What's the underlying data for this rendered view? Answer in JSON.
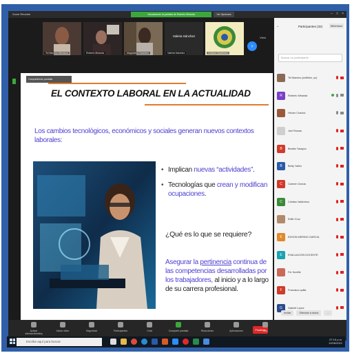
{
  "window": {
    "title": "Zoom Reunión",
    "banner": "Visualizando la pantalla de Roberto Miranda",
    "view_button": "Ver Opciones",
    "controls": [
      "–",
      "□",
      "×"
    ]
  },
  "thumbnails": [
    {
      "name": "Tel Maximo Mendoza",
      "kind": "video",
      "color": "#6b4a3a"
    },
    {
      "name": "Roberto Miranda",
      "kind": "video",
      "color": "#3a2a2a"
    },
    {
      "name": "Magdalena Sanchez",
      "kind": "video",
      "color": "#7a6a55"
    },
    {
      "name": "Valeria Sánchez",
      "kind": "name",
      "center_label": "Valeria Sánchez"
    },
    {
      "name": "Cristian Valdivieso",
      "kind": "logo",
      "color": "#d8c84a"
    }
  ],
  "view_toggle": "Vista",
  "slide": {
    "tab_label": "Compartiendo pantalla",
    "title": "EL CONTEXTO LABORAL EN LA ACTUALIDAD",
    "intro": "Los cambios tecnológicos, económicos y sociales generan nuevos contextos laborales:",
    "bullet1_pre": "Implican ",
    "bullet1_hl": "nuevas “actividades”",
    "bullet1_post": ".",
    "bullet2_pre": "Tecnologías que ",
    "bullet2_hl": "crean y modifican ocupaciones",
    "bullet2_post": ".",
    "question": "¿Qué es lo que se requiere?",
    "answer_a": "Asegurar la ",
    "answer_u": "pertinencia",
    "answer_b": " continua de las competencias desarrolladas por los trabajadores,",
    "answer_c": " al inicio y a lo largo de su carrera profesional.",
    "accent_color": "#e07b2e",
    "highlight_color": "#4b3fd0"
  },
  "participants": {
    "header": "Participantes (32)",
    "popout_label": "Minimizar",
    "search_placeholder": "Buscar un participante",
    "list": [
      {
        "name": "Tel Maximo (anfitrión, yo)",
        "avatar": "photo",
        "color": "#8a6a55",
        "mic": false,
        "cam": false
      },
      {
        "name": "Roberto Miranda",
        "avatar": "R",
        "color": "#7a3fc8",
        "mic": true,
        "cam": true,
        "active": true
      },
      {
        "name": "Héctor Chacha",
        "avatar": "photo",
        "color": "#9a5a3a",
        "mic": true,
        "cam": true
      },
      {
        "name": "Joel Romas",
        "avatar": "photo",
        "color": "#cfcfcf",
        "mic": false,
        "cam": false
      },
      {
        "name": "Beatriz Tasayco",
        "avatar": "B",
        "color": "#d13a2a",
        "mic": false,
        "cam": false
      },
      {
        "name": "Betty Yañez",
        "avatar": "B",
        "color": "#2a5aa8",
        "mic": false,
        "cam": false
      },
      {
        "name": "Carmen Garcia",
        "avatar": "C",
        "color": "#d13a2a",
        "mic": false,
        "cam": false
      },
      {
        "name": "Cristian Valdivieso",
        "avatar": "C",
        "color": "#3a8a3a",
        "mic": false,
        "cam": false
      },
      {
        "name": "Edith Cruz",
        "avatar": "photo",
        "color": "#b08a6a",
        "mic": false,
        "cam": false
      },
      {
        "name": "EDSON MERINO GARCIA",
        "avatar": "E",
        "color": "#e0882a",
        "mic": false,
        "cam": false
      },
      {
        "name": "EVALUACION DOCENTE",
        "avatar": "E",
        "color": "#1aa3b0",
        "mic": false,
        "cam": false
      },
      {
        "name": "Fer Norrille",
        "avatar": "photo",
        "color": "#c86a5a",
        "mic": false,
        "cam": false
      },
      {
        "name": "Francisco quilla",
        "avatar": "F",
        "color": "#d13a2a",
        "mic": false,
        "cam": false
      },
      {
        "name": "Gabriel López",
        "avatar": "G",
        "color": "#2a4a8a",
        "mic": false,
        "cam": false
      }
    ],
    "invite_button": "Invitar",
    "mute_all_button": "Silenciar a todos",
    "more_button": "..."
  },
  "toolbar": {
    "items": [
      {
        "label": "Activar silencio/desbloq",
        "green": false
      },
      {
        "label": "Iniciar video",
        "green": false
      },
      {
        "label": "Seguridad",
        "green": false
      },
      {
        "label": "Participantes",
        "green": false
      },
      {
        "label": "Chat",
        "green": false
      },
      {
        "label": "Compartir pantalla",
        "green": true
      },
      {
        "label": "Reacciones",
        "green": false
      },
      {
        "label": "Aplicaciones",
        "green": false
      },
      {
        "label": "Más",
        "green": false
      }
    ],
    "end_label": "Finalizar"
  },
  "taskbar": {
    "search_placeholder": "Escribe aquí para buscar",
    "time": "07:15 p.m.",
    "date": "12/06/2021"
  }
}
